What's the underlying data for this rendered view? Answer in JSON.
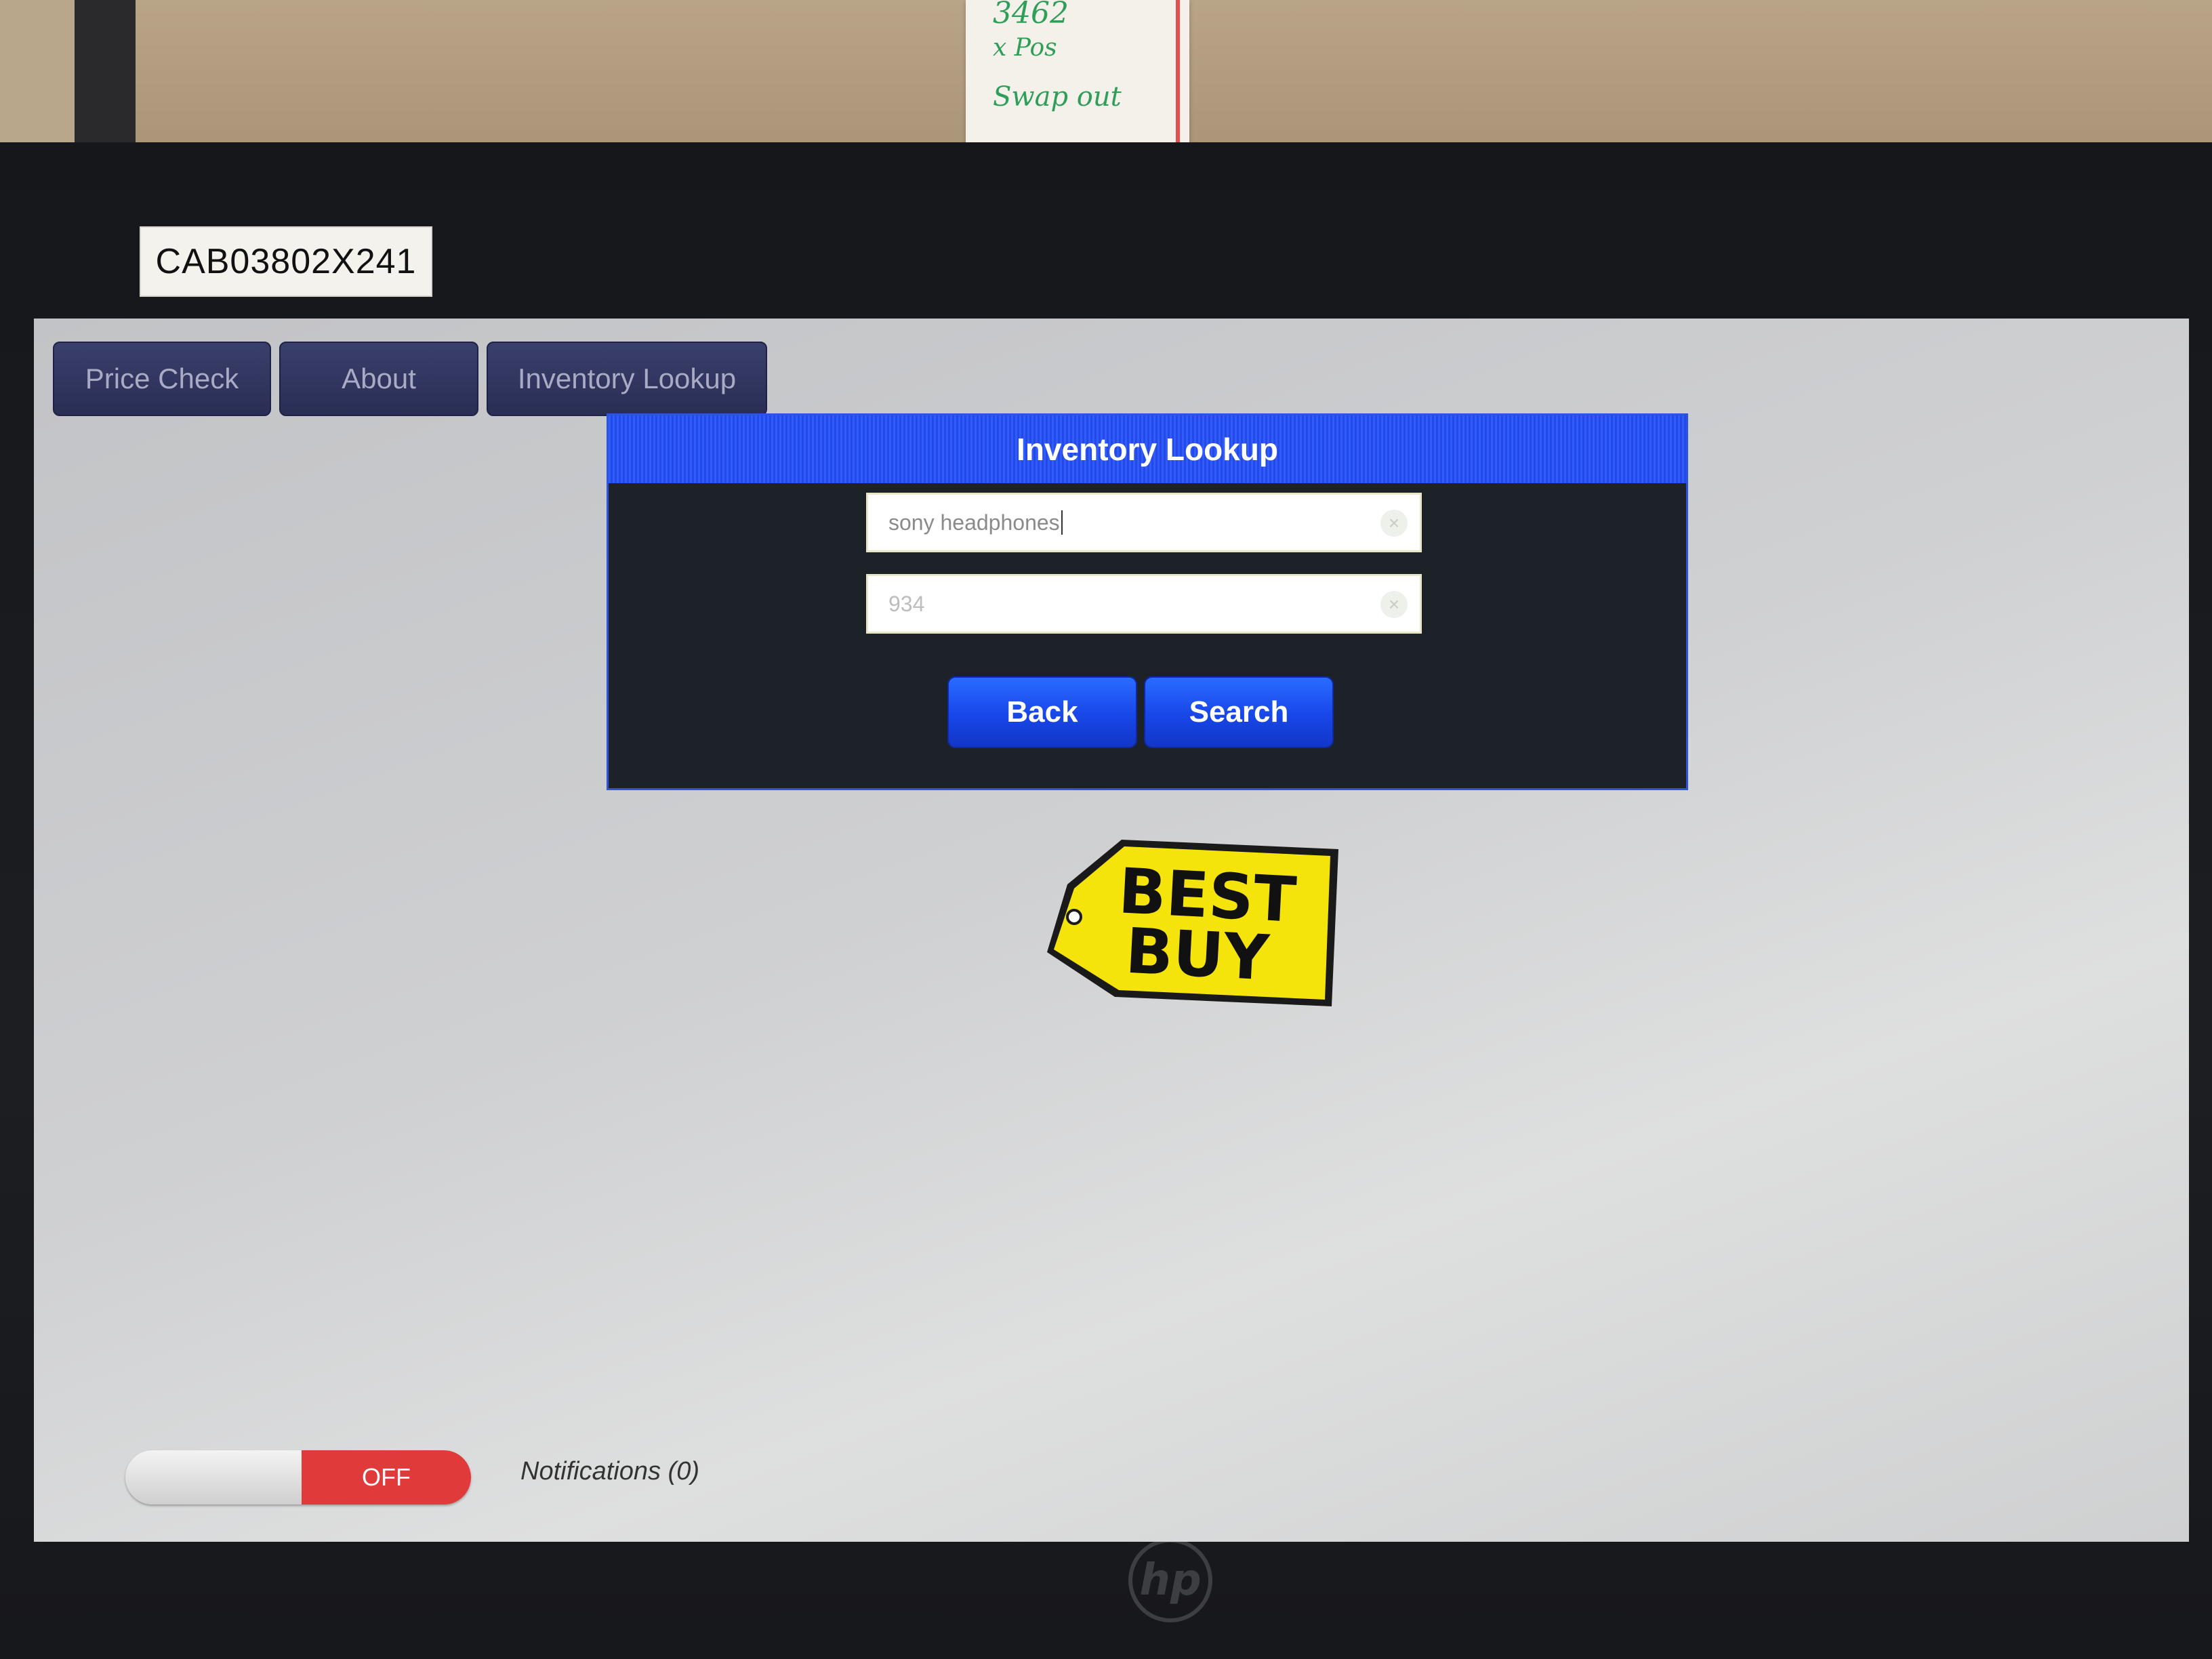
{
  "wall": {
    "note_lines": [
      "3462",
      "x Pos",
      "Swap out"
    ]
  },
  "monitor": {
    "asset_tag": "CAB03802X241",
    "brand": "hp"
  },
  "tabs": [
    {
      "label": "Price Check"
    },
    {
      "label": "About"
    },
    {
      "label": "Inventory Lookup"
    }
  ],
  "dialog": {
    "title": "Inventory Lookup",
    "query_value": "sony headphones",
    "store_value": "934",
    "back_label": "Back",
    "search_label": "Search"
  },
  "logo": {
    "line1": "BEST",
    "line2": "BUY"
  },
  "footer": {
    "toggle_state": "OFF",
    "notifications": "Notifications (0)"
  },
  "colors": {
    "dialog_accent": "#2f5cff",
    "tab_bg": "#2f3361",
    "toggle_off": "#e03a3a",
    "logo_yellow": "#f5e40b"
  }
}
